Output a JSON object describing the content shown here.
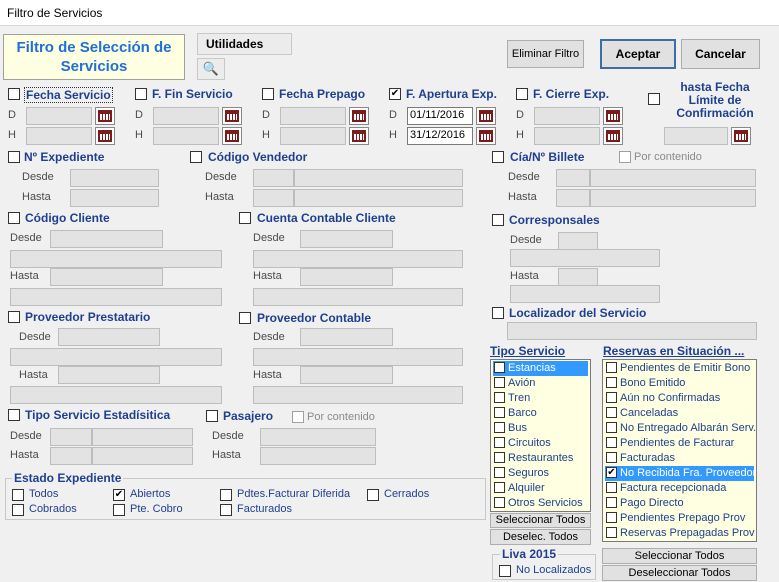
{
  "window": {
    "title": "Filtro de Servicios"
  },
  "header": {
    "title": "Filtro de Selección de Servicios"
  },
  "toolbar": {
    "utilidades": "Utilidades",
    "eliminar": "Eliminar Filtro",
    "aceptar": "Aceptar",
    "cancelar": "Cancelar"
  },
  "labels": {
    "D": "D",
    "H": "H",
    "desde": "Desde",
    "hasta": "Hasta",
    "por_contenido": "Por contenido"
  },
  "dates": {
    "fecha_servicio": "Fecha Servicio",
    "f_fin_servicio": "F. Fin Servicio",
    "fecha_prepago": "Fecha Prepago",
    "f_apertura_exp": "F. Apertura Exp.",
    "f_cierre_exp": "F. Cierre Exp.",
    "hasta_fecha": "hasta Fecha Límite de Confirmación",
    "apertura_desde": "01/11/2016",
    "apertura_hasta": "31/12/2016"
  },
  "sections": {
    "expediente": "Nº Expediente",
    "vendedor": "Código Vendedor",
    "billete": "Cía/Nº Billete",
    "cliente": "Código Cliente",
    "cuenta_contable": "Cuenta Contable Cliente",
    "corresponsales": "Corresponsales",
    "prestatario": "Proveedor Prestatario",
    "prov_contable": "Proveedor Contable",
    "localizador": "Localizador del Servicio",
    "tipo_estadistica": "Tipo Servicio Estadísitica",
    "pasajero": "Pasajero"
  },
  "estado": {
    "title": "Estado Expediente",
    "items": [
      "Todos",
      "Abiertos",
      "Pdtes.Facturar Diferida",
      "Cerrados",
      "Cobrados",
      "Pte. Cobro",
      "Facturados"
    ]
  },
  "tipo_servicio": {
    "title": "Tipo Servicio",
    "items": [
      "Estancias",
      "Avión",
      "Tren",
      "Barco",
      "Bus",
      "Circuitos",
      "Restaurantes",
      "Seguros",
      "Alquiler",
      "Otros Servicios"
    ],
    "sel_all": "Seleccionar Todos",
    "desel": "Deselec. Todos"
  },
  "reservas": {
    "title": "Reservas en Situación ...",
    "items": [
      "Pendientes de Emitir Bono",
      "Bono Emitido",
      "Aún no Confirmadas",
      "Canceladas",
      "No Entregado Albarán Serv.",
      "Pendientes de Facturar",
      "Facturadas",
      "No Recibida Fra. Proveedor",
      "Factura recepcionada",
      "Pago Directo",
      "Pendientes Prepago Prov",
      "Reservas Prepagadas Prov"
    ],
    "sel_all": "Seleccionar Todos",
    "desel_all": "Deseleccionar Todos"
  },
  "liva": {
    "title": "Liva 2015",
    "no_localizados": "No Localizados"
  }
}
